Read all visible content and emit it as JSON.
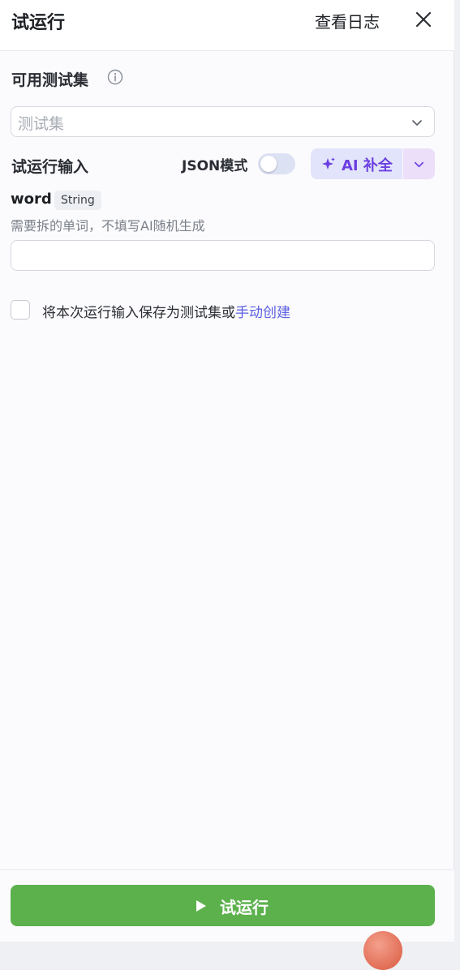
{
  "header": {
    "title": "试运行",
    "view_log": "查看日志"
  },
  "test_set": {
    "label": "可用测试集",
    "placeholder": "测试集"
  },
  "run_input": {
    "label": "试运行输入",
    "json_mode_label": "JSON模式",
    "json_mode_on": false,
    "ai_complete_label": "AI 补全"
  },
  "field": {
    "name": "word",
    "type": "String",
    "description": "需要拆的单词，不填写AI随机生成",
    "value": ""
  },
  "save_option": {
    "checked": false,
    "text": "将本次运行输入保存为测试集或",
    "link": "手动创建"
  },
  "footer": {
    "run_label": "试运行"
  },
  "colors": {
    "primary_green": "#5cb14d",
    "accent_purple": "#6b3fe0",
    "link_blue": "#5b5fe0"
  }
}
